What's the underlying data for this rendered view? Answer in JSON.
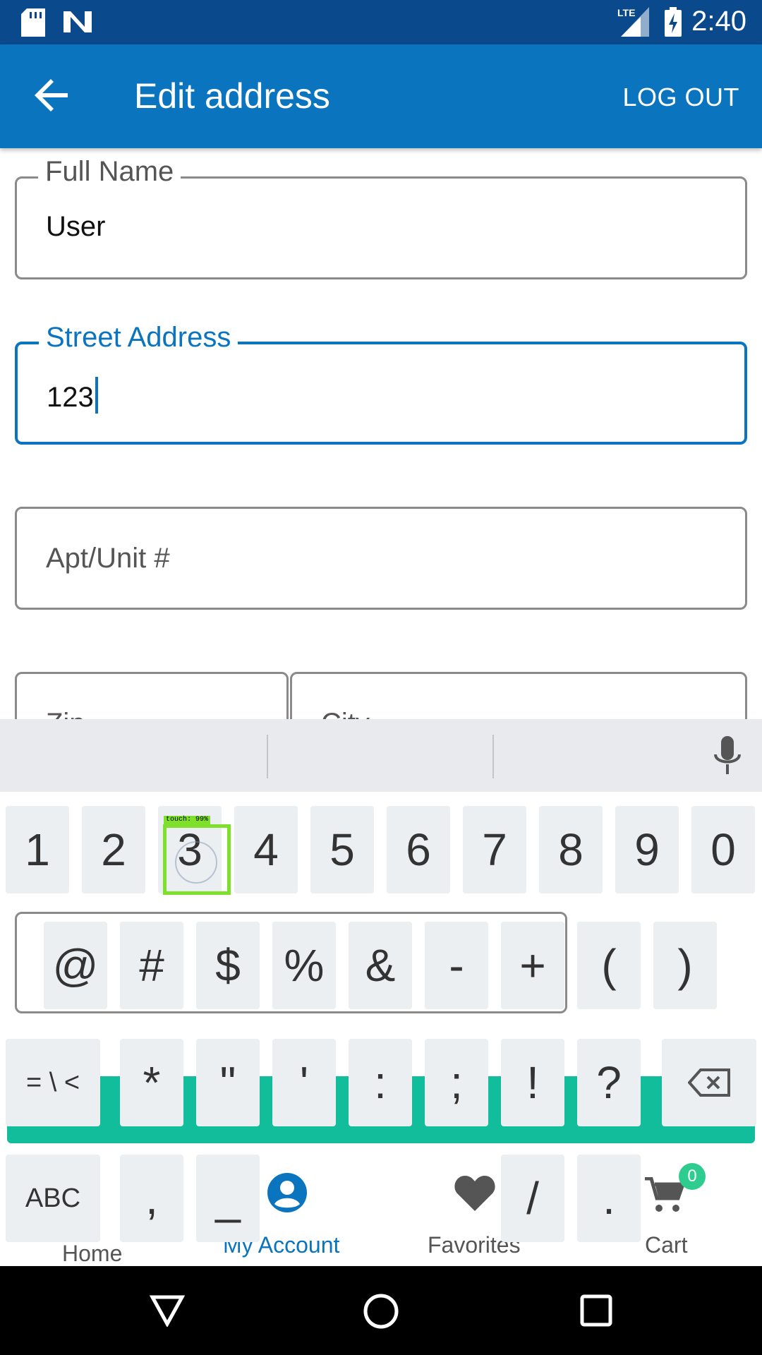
{
  "status_bar": {
    "time": "2:40",
    "network": "LTE"
  },
  "app_bar": {
    "title": "Edit address",
    "logout_label": "LOG OUT"
  },
  "form": {
    "full_name": {
      "label": "Full Name",
      "value": "User"
    },
    "street_address": {
      "label": "Street Address",
      "value": "123"
    },
    "apt_unit": {
      "placeholder": "Apt/Unit #"
    },
    "zip": {
      "label": "Zip"
    },
    "city": {
      "label": "City"
    }
  },
  "bottom_nav": {
    "items": [
      {
        "label": "Home",
        "icon": "home-icon",
        "active": false
      },
      {
        "label": "My Account",
        "icon": "account-icon",
        "active": true
      },
      {
        "label": "Favorites",
        "icon": "heart-icon",
        "active": false
      },
      {
        "label": "Cart",
        "icon": "cart-icon",
        "active": false,
        "badge": "0"
      }
    ]
  },
  "touch_indicator": "touch: 99%",
  "keyboard": {
    "row1": [
      "1",
      "2",
      "3",
      "4",
      "5",
      "6",
      "7",
      "8",
      "9",
      "0"
    ],
    "row2": [
      "@",
      "#",
      "$",
      "%",
      "&",
      "-",
      "+",
      "(",
      ")"
    ],
    "row3": [
      "= \\ <",
      "*",
      "\"",
      "'",
      ":",
      ";",
      "!",
      "?"
    ],
    "row4": [
      "ABC",
      ",",
      "_",
      "/",
      "."
    ]
  },
  "colors": {
    "accent": "#0b74bf",
    "app_bar": "#0b74bf",
    "status_bar": "#0a4a8c",
    "teal": "#12bd9b",
    "badge": "#2ecc8f"
  }
}
